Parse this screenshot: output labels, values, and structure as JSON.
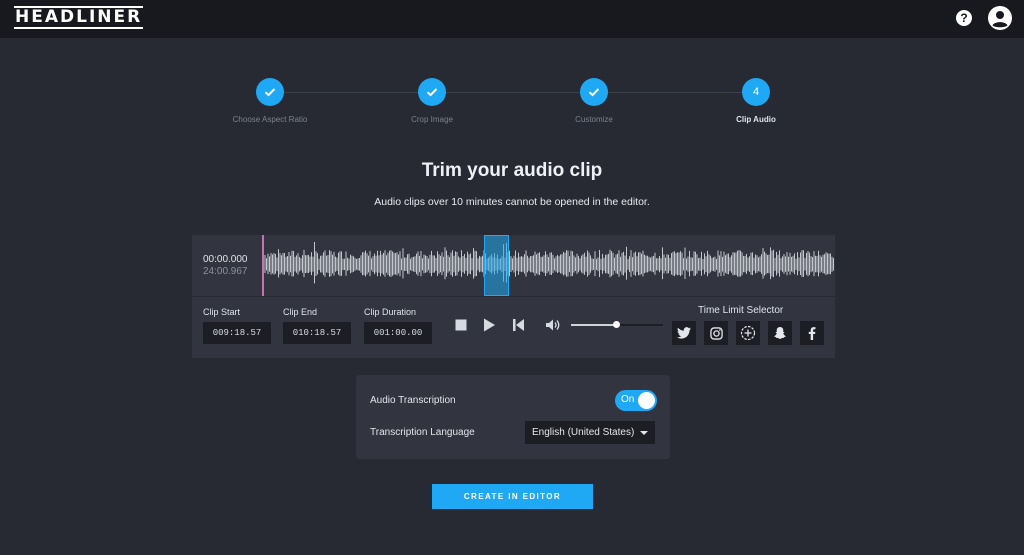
{
  "app": {
    "logo_text": "HEADLINER",
    "help_label": "?"
  },
  "colors": {
    "accent": "#1fa8f3",
    "playhead": "#d46ab0",
    "background": "#272a33",
    "topbar": "#17191e",
    "panel": "#32353f"
  },
  "icons": [
    "help-icon",
    "user-avatar-icon",
    "check-icon",
    "stop-icon",
    "play-icon",
    "skip-back-icon",
    "volume-icon",
    "twitter-icon",
    "instagram-icon",
    "add-circle-icon",
    "snapchat-icon",
    "facebook-icon",
    "chevron-down-icon"
  ],
  "steps": [
    {
      "label": "Choose Aspect Ratio",
      "state": "done"
    },
    {
      "label": "Crop Image",
      "state": "done"
    },
    {
      "label": "Customize",
      "state": "done"
    },
    {
      "label": "Clip Audio",
      "number": "4",
      "state": "active"
    }
  ],
  "page": {
    "title": "Trim your audio clip",
    "subtitle": "Audio clips over 10 minutes cannot be opened in the editor."
  },
  "waveform": {
    "current_time": "00:00.000",
    "total_time": "24:00.967"
  },
  "clip": {
    "start_label": "Clip Start",
    "start_value": "009:18.57",
    "end_label": "Clip End",
    "end_value": "010:18.57",
    "duration_label": "Clip Duration",
    "duration_value": "001:00.00"
  },
  "volume": {
    "level": 0.5
  },
  "time_limit": {
    "label": "Time Limit Selector"
  },
  "transcription": {
    "label": "Audio Transcription",
    "toggle_label": "On",
    "language_label": "Transcription Language",
    "language_value": "English (United States)"
  },
  "cta": {
    "label": "CREATE IN EDITOR"
  }
}
